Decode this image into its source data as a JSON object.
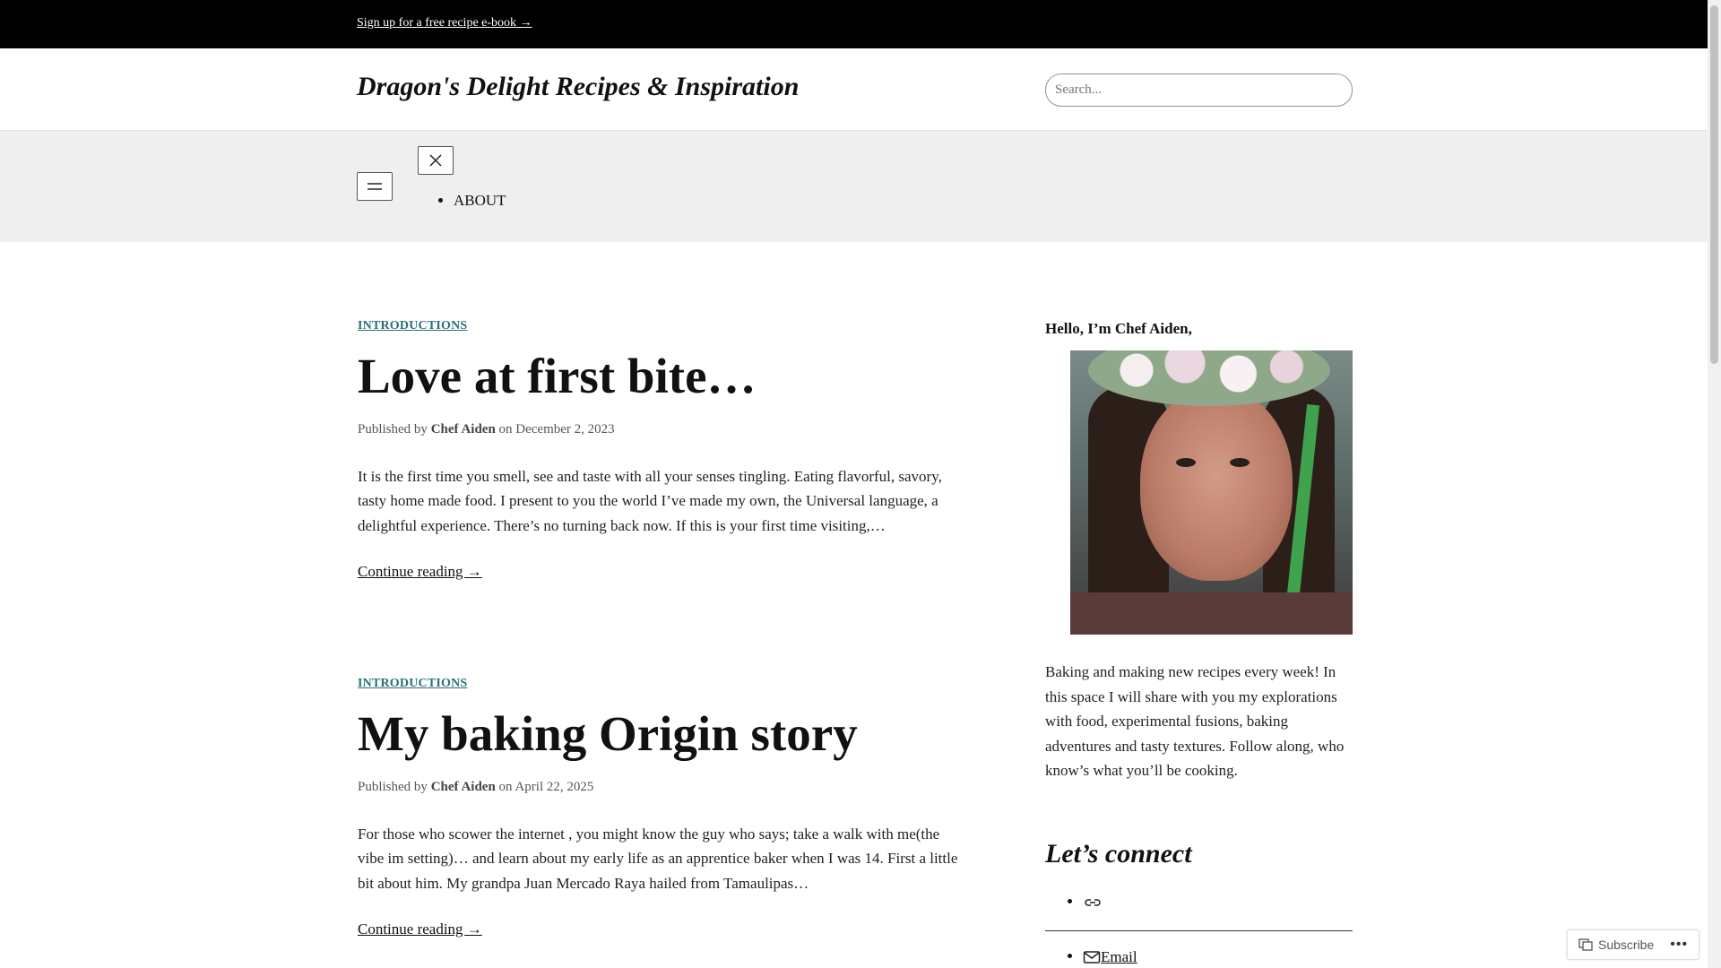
{
  "topbar": {
    "promo_link": "Sign up for a free recipe e-book →"
  },
  "header": {
    "site_title": "Dragon's Delight Recipes & Inspiration",
    "search_placeholder": "Search..."
  },
  "nav": {
    "items": [
      {
        "label": "ABOUT"
      }
    ]
  },
  "posts": [
    {
      "category": "INTRODUCTIONS",
      "title": "Love at first bite…",
      "meta_prefix": "Published by",
      "author": "Chef Aiden",
      "meta_on": "on",
      "date": "December 2, 2023",
      "excerpt": "It is the first time you smell, see and taste with all your senses tingling. Eating flavorful, savory, tasty home made food. I present to you the world I’ve made my own, the Universal language, a delightful experience. There’s no turning back now. If this is your first time visiting,…",
      "more": "Continue reading →"
    },
    {
      "category": "INTRODUCTIONS",
      "title": "My baking Origin story",
      "meta_prefix": "Published by",
      "author": "Chef Aiden",
      "meta_on": "on",
      "date": "April 22, 2025",
      "excerpt": "For those who scower the internet , you might know the guy who says; take a walk with me(the vibe im setting)… and learn about my early life as an apprentice baker when I was 14. First a little bit about him. My grandpa Juan Mercado Raya hailed from Tamaulipas…",
      "more": "Continue reading →"
    }
  ],
  "sidebar": {
    "hello": "Hello, I’m Chef Aiden,",
    "bio": "Baking and making new recipes every week! In this space I will share with you my explorations with food, experimental fusions, baking adventures and tasty textures. Follow along, who know’s what you’ll be cooking.",
    "connect_heading": "Let’s connect",
    "email_label": "Email"
  },
  "subscribe": {
    "label": "Subscribe",
    "more": "•••"
  },
  "colors": {
    "category_link": "#2a6f7a",
    "topbar_bg": "#000000",
    "nav_bg": "#efefef"
  },
  "icons": [
    "menu-icon",
    "close-icon",
    "link-icon",
    "mail-icon",
    "subscribe-icon"
  ]
}
